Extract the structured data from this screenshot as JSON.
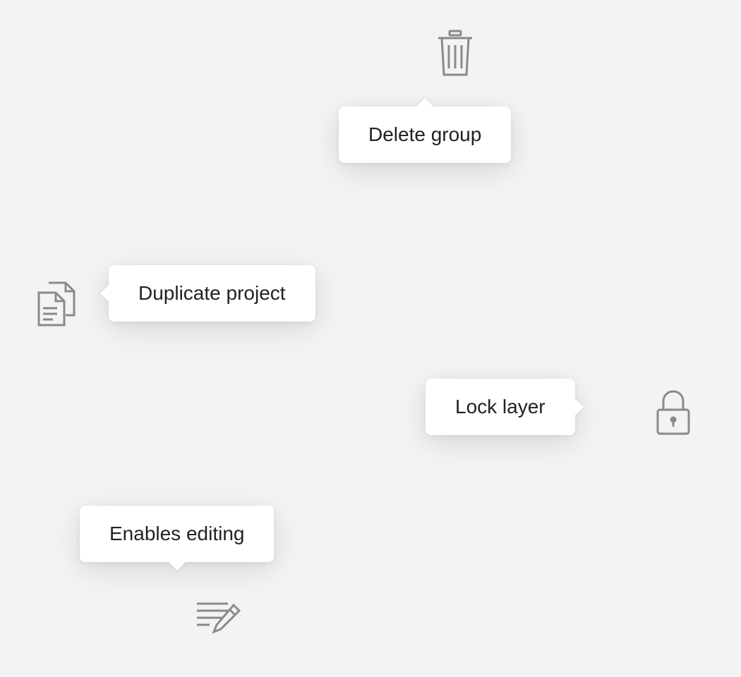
{
  "tooltips": {
    "delete": {
      "label": "Delete group"
    },
    "duplicate": {
      "label": "Duplicate project"
    },
    "lock": {
      "label": "Lock layer"
    },
    "editing": {
      "label": "Enables editing"
    }
  },
  "icons": {
    "trash": "trash-icon",
    "duplicate": "duplicate-icon",
    "lock": "lock-icon",
    "edit": "edit-icon"
  }
}
